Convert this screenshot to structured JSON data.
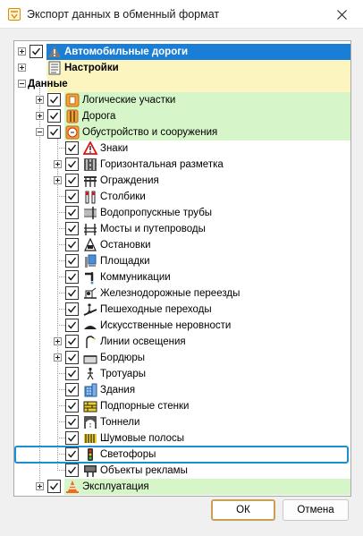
{
  "window": {
    "title": "Экспорт данных в обменный формат"
  },
  "buttons": {
    "ok": "ОК",
    "cancel": "Отмена"
  },
  "tree": [
    {
      "label": "Автомобильные дороги",
      "icon": "road-warning-icon",
      "bold": true,
      "highlight": "#1a7ed6",
      "text_color": "#ffffff",
      "expander": "plus",
      "checked": true
    },
    {
      "label": "Настройки",
      "icon": "settings-list-icon",
      "bold": true,
      "highlight": "#fdf5c0",
      "expander": "plus",
      "checked": null
    },
    {
      "label": "Данные",
      "icon": "",
      "bold": true,
      "highlight": "#fdf5c0",
      "expander": "minus",
      "checked": null
    },
    {
      "label": "Логические участки",
      "icon": "logical-sections-icon",
      "highlight": "#d6f5c8",
      "expander": "plus",
      "checked": true
    },
    {
      "label": "Дорога",
      "icon": "road-icon",
      "highlight": "#d6f5c8",
      "expander": "plus",
      "checked": true
    },
    {
      "label": "Обустройство и сооружения",
      "icon": "speed-sign-icon",
      "highlight": "#d6f5c8",
      "expander": "minus",
      "checked": true
    },
    {
      "label": "Знаки",
      "icon": "warning-sign-icon",
      "expander": "",
      "checked": true
    },
    {
      "label": "Горизонтальная разметка",
      "icon": "road-marking-icon",
      "expander": "plus",
      "checked": true
    },
    {
      "label": "Ограждения",
      "icon": "barrier-icon",
      "expander": "plus",
      "checked": true
    },
    {
      "label": "Столбики",
      "icon": "bollard-icon",
      "expander": "",
      "checked": true
    },
    {
      "label": "Водопропускные трубы",
      "icon": "culvert-icon",
      "expander": "",
      "checked": true
    },
    {
      "label": "Мосты и путепроводы",
      "icon": "bridge-icon",
      "expander": "",
      "checked": true
    },
    {
      "label": "Остановки",
      "icon": "bus-stop-icon",
      "expander": "",
      "checked": true
    },
    {
      "label": "Площадки",
      "icon": "platform-icon",
      "expander": "",
      "checked": true
    },
    {
      "label": "Коммуникации",
      "icon": "utility-pipe-icon",
      "expander": "",
      "checked": true
    },
    {
      "label": "Железнодорожные переезды",
      "icon": "railway-crossing-icon",
      "expander": "",
      "checked": true
    },
    {
      "label": "Пешеходные переходы",
      "icon": "pedestrian-crossing-icon",
      "expander": "",
      "checked": true
    },
    {
      "label": "Искусственные неровности",
      "icon": "speed-bump-icon",
      "expander": "",
      "checked": true
    },
    {
      "label": "Линии освещения",
      "icon": "street-light-icon",
      "expander": "plus",
      "checked": true
    },
    {
      "label": "Бордюры",
      "icon": "curb-icon",
      "expander": "plus",
      "checked": true
    },
    {
      "label": "Тротуары",
      "icon": "sidewalk-icon",
      "expander": "",
      "checked": true
    },
    {
      "label": "Здания",
      "icon": "building-icon",
      "expander": "",
      "checked": true
    },
    {
      "label": "Подпорные стенки",
      "icon": "retaining-wall-icon",
      "expander": "",
      "checked": true
    },
    {
      "label": "Тоннели",
      "icon": "tunnel-icon",
      "expander": "",
      "checked": true
    },
    {
      "label": "Шумовые полосы",
      "icon": "rumble-strip-icon",
      "expander": "",
      "checked": true
    },
    {
      "label": "Светофоры",
      "icon": "traffic-light-icon",
      "expander": "",
      "checked": true,
      "focused": true
    },
    {
      "label": "Объекты рекламы",
      "icon": "billboard-icon",
      "expander": "",
      "checked": true
    },
    {
      "label": "Эксплуатация",
      "icon": "traffic-cone-icon",
      "highlight": "#d6f5c8",
      "expander": "plus",
      "checked": true
    }
  ]
}
